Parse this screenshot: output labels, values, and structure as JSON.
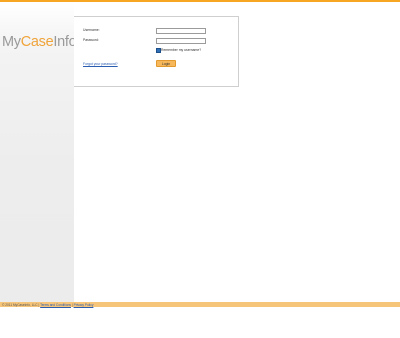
{
  "brand": {
    "logo_prefix": "My",
    "logo_case": "Case",
    "logo_suffix": "Info",
    "logo_mark": "®"
  },
  "login": {
    "username_label": "Username:",
    "password_label": "Password:",
    "username_value": "",
    "password_value": "",
    "remember_label": "Remember my username?",
    "remember_checked": true,
    "forgot_link": "Forgot your password?",
    "login_button": "Login"
  },
  "footer": {
    "copyright": "© 2011 MyCaseInfo, LLC |",
    "terms_link": "Terms and Conditions",
    "separator": "|",
    "privacy_link": "Privacy Policy"
  },
  "colors": {
    "accent": "#f6a623",
    "footer_bg": "#f6c57a",
    "link": "#2a5db0"
  }
}
